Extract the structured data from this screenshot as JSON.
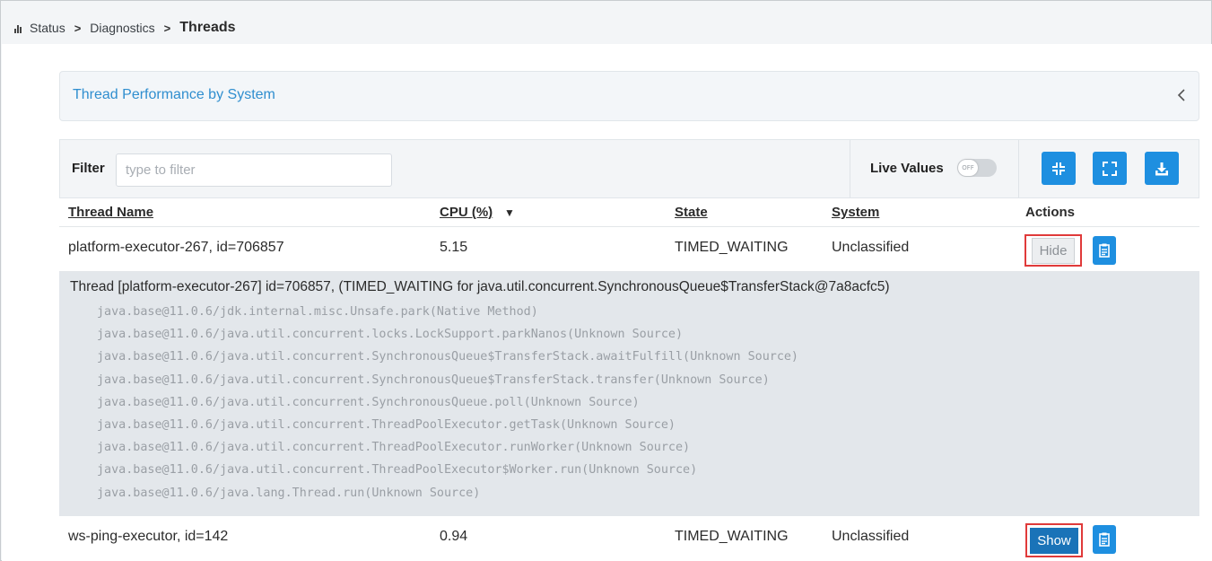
{
  "breadcrumb": {
    "items": [
      "Status",
      "Diagnostics"
    ],
    "current": "Threads",
    "separator": ">"
  },
  "accordion": {
    "title": "Thread Performance by System",
    "icon": "chevron-left-icon"
  },
  "toolbar": {
    "filter_label": "Filter",
    "filter_placeholder": "type to filter",
    "filter_value": "",
    "live_values_label": "Live Values",
    "toggle_state": "OFF",
    "buttons": [
      "collapse-all-icon",
      "expand-all-icon",
      "download-icon"
    ]
  },
  "table": {
    "headers": {
      "thread_name": "Thread Name",
      "cpu": "CPU (%)",
      "cpu_sort": "▼",
      "state": "State",
      "system": "System",
      "actions": "Actions"
    },
    "rows": [
      {
        "thread_name": "platform-executor-267, id=706857",
        "cpu": "5.15",
        "state": "TIMED_WAITING",
        "system": "Unclassified",
        "action_label": "Hide"
      },
      {
        "thread_name": "ws-ping-executor, id=142",
        "cpu": "0.94",
        "state": "TIMED_WAITING",
        "system": "Unclassified",
        "action_label": "Show"
      }
    ],
    "trace": {
      "header": "Thread [platform-executor-267] id=706857, (TIMED_WAITING for java.util.concurrent.SynchronousQueue$TransferStack@7a8acfc5)",
      "lines": [
        "java.base@11.0.6/jdk.internal.misc.Unsafe.park(Native Method)",
        "java.base@11.0.6/java.util.concurrent.locks.LockSupport.parkNanos(Unknown Source)",
        "java.base@11.0.6/java.util.concurrent.SynchronousQueue$TransferStack.awaitFulfill(Unknown Source)",
        "java.base@11.0.6/java.util.concurrent.SynchronousQueue$TransferStack.transfer(Unknown Source)",
        "java.base@11.0.6/java.util.concurrent.SynchronousQueue.poll(Unknown Source)",
        "java.base@11.0.6/java.util.concurrent.ThreadPoolExecutor.getTask(Unknown Source)",
        "java.base@11.0.6/java.util.concurrent.ThreadPoolExecutor.runWorker(Unknown Source)",
        "java.base@11.0.6/java.util.concurrent.ThreadPoolExecutor$Worker.run(Unknown Source)",
        "java.base@11.0.6/java.lang.Thread.run(Unknown Source)"
      ]
    }
  },
  "colors": {
    "accent": "#1e8fe0",
    "link": "#2f8ecf",
    "highlight_border": "#e03a3a",
    "trace_background": "#e3e7eb"
  }
}
